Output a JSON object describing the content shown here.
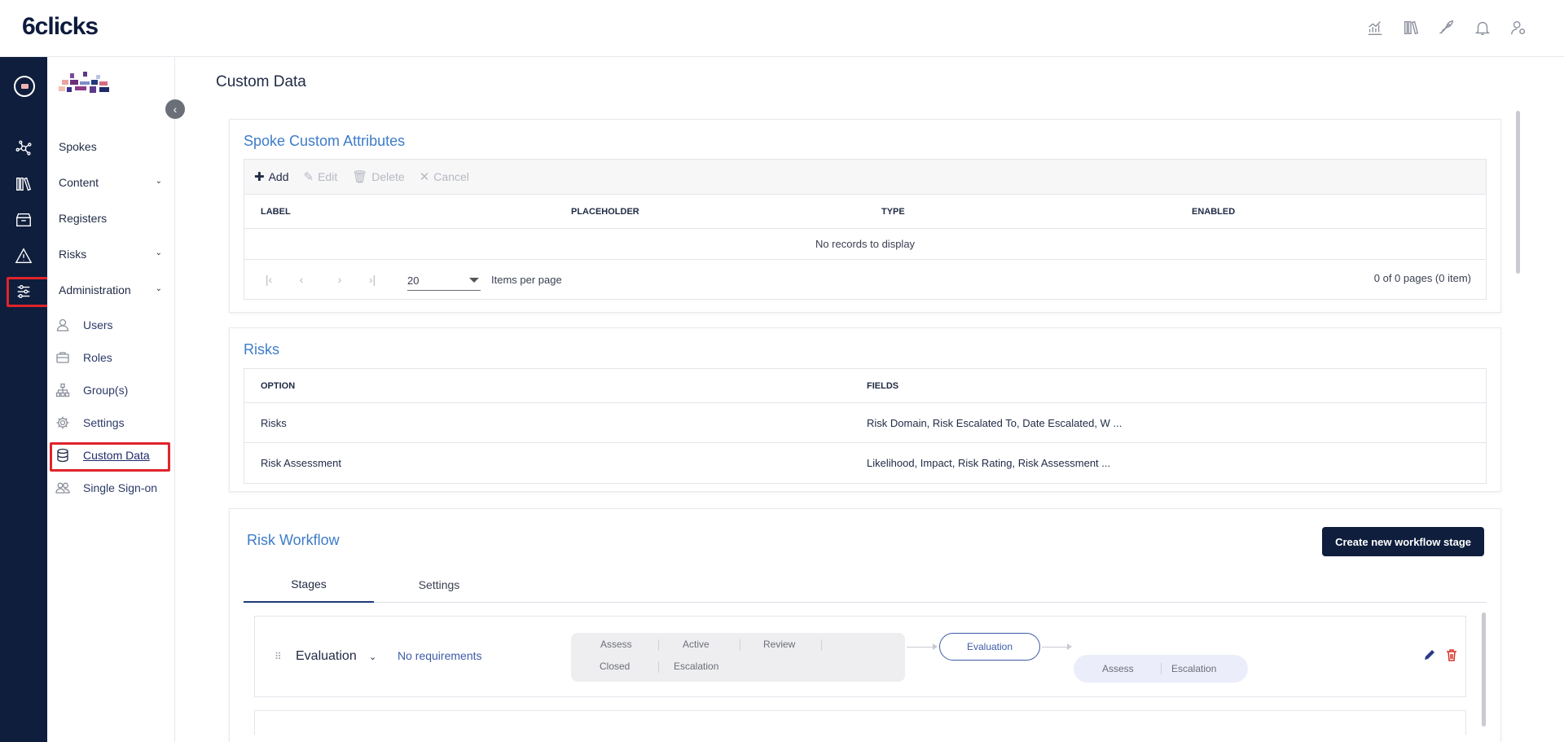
{
  "app": {
    "logo": "6clicks",
    "top_icons": [
      "analytics-icon",
      "library-icon",
      "rocket-icon",
      "bell-icon",
      "user-settings-icon"
    ]
  },
  "rail": {
    "icons": [
      "hub-icon",
      "books-icon",
      "register-icon",
      "warning-icon",
      "sliders-icon"
    ]
  },
  "sidebar": {
    "collapse_label": "‹",
    "items": [
      {
        "label": "Spokes"
      },
      {
        "label": "Content",
        "chevron": "⌄"
      },
      {
        "label": "Registers"
      },
      {
        "label": "Risks",
        "chevron": "⌄"
      },
      {
        "label": "Administration",
        "chevron": "⌄"
      }
    ],
    "sub_items": [
      {
        "label": "Users",
        "icon": "user-icon"
      },
      {
        "label": "Roles",
        "icon": "briefcase-icon"
      },
      {
        "label": "Group(s)",
        "icon": "hierarchy-icon"
      },
      {
        "label": "Settings",
        "icon": "gear-icon"
      },
      {
        "label": "Custom Data",
        "icon": "database-icon"
      },
      {
        "label": "Single Sign-on",
        "icon": "users-icon"
      }
    ]
  },
  "page": {
    "title": "Custom Data"
  },
  "spoke_attributes": {
    "title": "Spoke Custom Attributes",
    "toolbar": {
      "add": "Add",
      "edit": "Edit",
      "delete": "Delete",
      "cancel": "Cancel"
    },
    "columns": [
      "LABEL",
      "PLACEHOLDER",
      "TYPE",
      "ENABLED"
    ],
    "empty_text": "No records to display",
    "pager": {
      "page_size": "20",
      "items_per_page_label": "Items per page",
      "info": "0 of 0 pages (0 item)"
    }
  },
  "risks": {
    "title": "Risks",
    "columns": [
      "OPTION",
      "FIELDS"
    ],
    "rows": [
      {
        "option": "Risks",
        "fields": "Risk Domain, Risk Escalated To, Date Escalated, W ..."
      },
      {
        "option": "Risk Assessment",
        "fields": "Likelihood, Impact, Risk Rating, Risk Assessment ..."
      }
    ]
  },
  "workflow": {
    "title": "Risk Workflow",
    "create_button": "Create new workflow stage",
    "tabs": [
      "Stages",
      "Settings"
    ],
    "active_tab": "Stages",
    "stage": {
      "name": "Evaluation",
      "requirements": "No requirements",
      "previous": [
        "Assess",
        "Active",
        "Review",
        "Closed",
        "Escalation"
      ],
      "current": "Evaluation",
      "next": [
        "Assess",
        "Escalation"
      ]
    }
  },
  "colors": {
    "rail_bg": "#0f1e3d",
    "accent_title": "#3d7cc9",
    "primary_button": "#0f1e3d",
    "highlight": "#e0242b",
    "delete_icon": "#d9342b"
  }
}
